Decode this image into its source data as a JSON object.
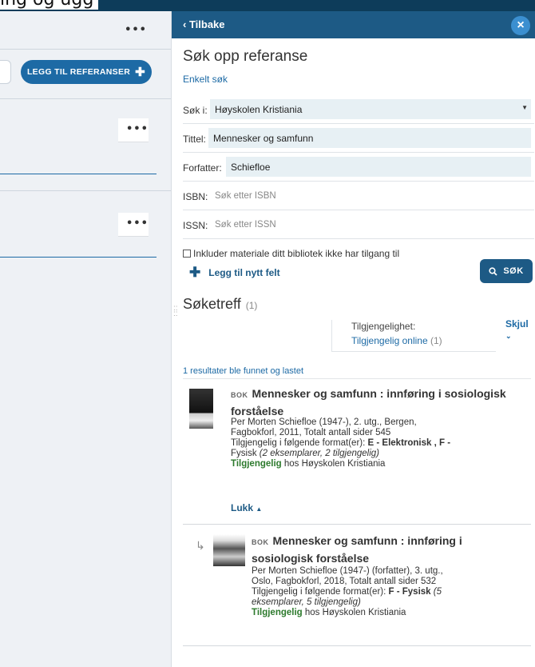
{
  "top": {
    "partial_title": "ing og ugg"
  },
  "left": {
    "more_label": "•••",
    "add_button_label": "LEGG TIL REFERANSER"
  },
  "panel": {
    "back_label": "Tilbake",
    "close_label": "×",
    "title": "Søk opp referanse",
    "mode_link": "Enkelt søk",
    "sok_i": {
      "label": "Søk i:",
      "value": "Høyskolen Kristiania"
    },
    "tittel": {
      "label": "Tittel:",
      "value": "Mennesker og samfunn"
    },
    "forfatter": {
      "label": "Forfatter:",
      "value": "Schiefloe"
    },
    "isbn": {
      "label": "ISBN:",
      "placeholder": "Søk etter ISBN"
    },
    "issn": {
      "label": "ISSN:",
      "placeholder": "Søk etter ISSN"
    },
    "include_label": "Inkluder materiale ditt bibliotek ikke har tilgang til",
    "add_field_label": "Legg til nytt felt",
    "search_button_label": "SØK",
    "results_title": "Søketreff",
    "results_count": "(1)",
    "filter": {
      "label": "Tilgjengelighet:",
      "value": "Tilgjengelig online",
      "count": "(1)",
      "hide_label": "Skjul"
    },
    "found_text": "1 resultater ble funnet og lastet",
    "collapse_label": "Lukk",
    "records": [
      {
        "type": "BOK",
        "title_l1": "Mennesker og samfunn : innføring i sosiologisk",
        "title_l2": "forståelse",
        "meta_l1": "Per Morten Schiefloe (1947-), 2. utg., Bergen,",
        "meta_l2": "Fagbokforl, 2011, Totalt antall sider 545",
        "format_prefix": "Tilgjengelig i følgende format(er): ",
        "format_l1_rest": "E - Elektronisk ,  F -",
        "format_l2": "Fysisk ",
        "format_l2_italic": "(2 eksemplarer, 2 tilgjengelig)",
        "avail_word": "Tilgjengelig",
        "avail_rest": " hos Høyskolen Kristiania"
      },
      {
        "type": "BOK",
        "title_l1": "Mennesker og samfunn : innføring i",
        "title_l2": "sosiologisk forståelse",
        "meta_l1": "Per Morten Schiefloe (1947-) (forfatter), 3. utg.,",
        "meta_l2": "Oslo, Fagbokforl, 2018, Totalt antall sider 532",
        "format_prefix": "Tilgjengelig i følgende format(er): ",
        "format_l1_rest": "F - Fysisk ",
        "format_l1_italic": "(5",
        "format_l2_italic": "eksemplarer, 5 tilgjengelig)",
        "avail_word": "Tilgjengelig",
        "avail_rest": " hos Høyskolen Kristiania"
      }
    ]
  }
}
